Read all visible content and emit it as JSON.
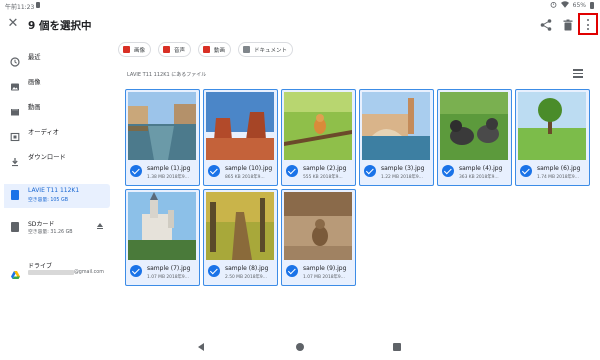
{
  "status_bar": {
    "time": "午前11:23",
    "battery": "65%"
  },
  "app_bar": {
    "title": "9 個を選択中",
    "icons": [
      "close-icon",
      "share-icon",
      "trash-icon",
      "more-vert-icon"
    ],
    "highlight_color": "#e00000"
  },
  "sidebar": {
    "items": [
      {
        "label": "最近",
        "icon": "clock-icon"
      },
      {
        "label": "画像",
        "icon": "image-icon"
      },
      {
        "label": "動画",
        "icon": "movie-icon"
      },
      {
        "label": "オーディオ",
        "icon": "audio-icon"
      },
      {
        "label": "ダウンロード",
        "icon": "download-icon"
      }
    ],
    "storage": [
      {
        "label": "LAVIE T11 112K1",
        "sub": "空き容量: 105 GB",
        "icon": "tablet-icon"
      },
      {
        "label": "SDカード",
        "sub": "空き容量: 31.26 GB",
        "icon": "sd-card-icon"
      },
      {
        "label": "ドライブ",
        "sub": "@gmail.com",
        "icon": "drive-icon"
      }
    ]
  },
  "filters": [
    {
      "label": "画像",
      "icon": "image-icon",
      "color": "#d93025"
    },
    {
      "label": "音声",
      "icon": "audio-icon",
      "color": "#d93025"
    },
    {
      "label": "動画",
      "icon": "movie-icon",
      "color": "#d93025"
    },
    {
      "label": "ドキュメント",
      "icon": "document-icon",
      "color": "#80868b"
    }
  ],
  "location_label": "LAVIE T11 112K1 にあるファイル",
  "files": [
    {
      "name": "sample (1).jpg",
      "meta": "1.38 MB 2018年9..."
    },
    {
      "name": "sample (10).jpg",
      "meta": "865 KB 2018年9..."
    },
    {
      "name": "sample (2).jpg",
      "meta": "555 KB 2018年9..."
    },
    {
      "name": "sample (3).jpg",
      "meta": "1.22 MB 2018年9..."
    },
    {
      "name": "sample (4).jpg",
      "meta": "363 KB 2018年9..."
    },
    {
      "name": "sample (6).jpg",
      "meta": "1.74 MB 2018年9..."
    },
    {
      "name": "sample (7).jpg",
      "meta": "1.07 MB 2018年9..."
    },
    {
      "name": "sample (8).jpg",
      "meta": "2.50 MB 2018年9..."
    },
    {
      "name": "sample (9).jpg",
      "meta": "1.07 MB 2018年9..."
    }
  ],
  "accent_color": "#1a73e8"
}
